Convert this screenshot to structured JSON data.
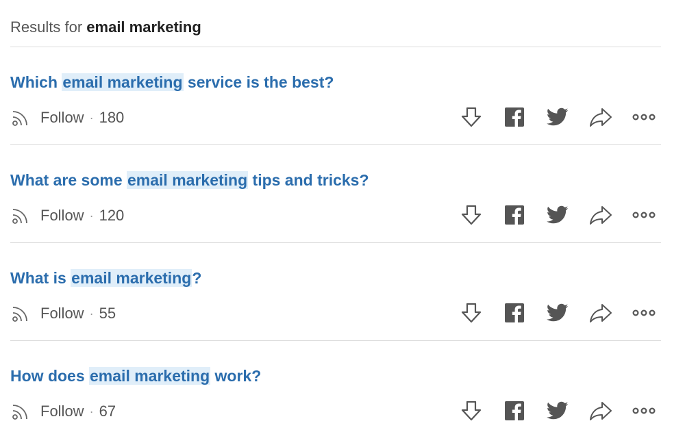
{
  "header": {
    "prefix": "Results for",
    "query": "email marketing"
  },
  "results": [
    {
      "before": "Which ",
      "highlight": "email marketing",
      "after": " service is the best?",
      "follow_label": "Follow",
      "separator": "·",
      "follower_count": "180"
    },
    {
      "before": "What are some ",
      "highlight": "email marketing",
      "after": " tips and tricks?",
      "follow_label": "Follow",
      "separator": "·",
      "follower_count": "120"
    },
    {
      "before": "What is ",
      "highlight": "email marketing",
      "after": "?",
      "follow_label": "Follow",
      "separator": "·",
      "follower_count": "55"
    },
    {
      "before": "How does ",
      "highlight": "email marketing",
      "after": " work?",
      "follow_label": "Follow",
      "separator": "·",
      "follower_count": "67"
    }
  ],
  "icons": {
    "follow": "rss-feed-icon",
    "downvote": "downvote-arrow-icon",
    "facebook": "facebook-icon",
    "twitter": "twitter-icon",
    "share": "share-arrow-icon",
    "more": "more-options-icon"
  },
  "colors": {
    "link": "#2b6dad",
    "highlight": "#e0eef9",
    "icon": "#555555",
    "divider": "#dcdcdc"
  }
}
